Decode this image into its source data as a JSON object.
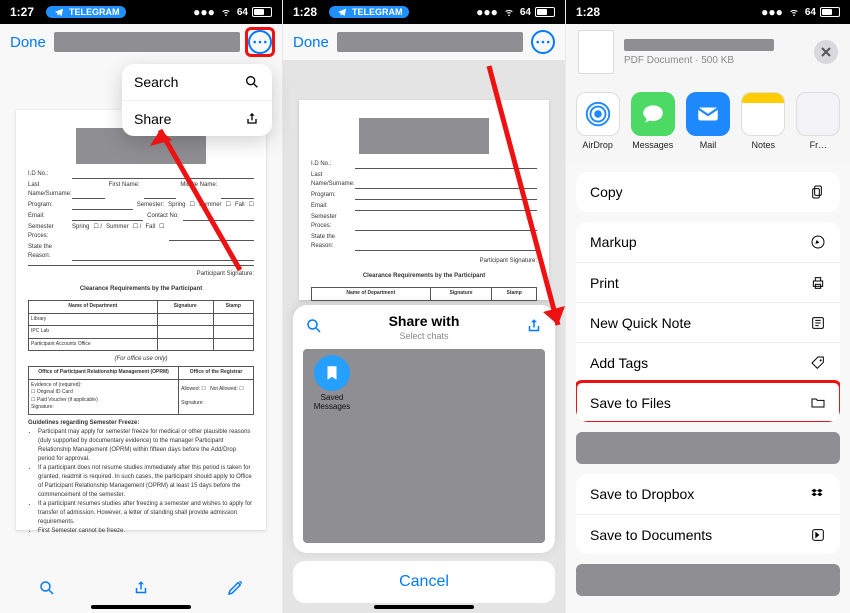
{
  "status": {
    "time1": "1:27",
    "time2": "1:28",
    "time3": "1:28",
    "tg": "TELEGRAM",
    "batt": "64"
  },
  "header": {
    "done": "Done"
  },
  "menu": {
    "search": "Search",
    "share": "Share"
  },
  "doc": {
    "fields": [
      "I.D No.:",
      "Last Name/Surname:",
      "Program:",
      "Email:",
      "Semester Proces:",
      "State the Reason:"
    ],
    "first": "First Name:",
    "middle": "Middle Name:",
    "sem": "Semester:",
    "spring": "Spring",
    "summer": "Summer",
    "fall": "Fall",
    "partSig": "Participant Signature:",
    "h1": "Clearance Requirements by the Participant",
    "cols": [
      "Name of Department",
      "Signature",
      "Stamp"
    ],
    "rows": [
      "Library",
      "IPC Lab",
      "Participant Accounts Office"
    ],
    "foruse": "(For office use only)",
    "left": "Office of Participant Relationship Management (OPRM)",
    "right": "Office of the Registrar",
    "ev": "Evidence of (required):",
    "oc": "Original ID Card",
    "pv": "Paid Voucher (if applicable)",
    "allowed": "Allowed:",
    "notallowed": "Not Allowed:",
    "sig": "Signature:",
    "guidelines": "Guidelines regarding Semester Freeze:",
    "g1": "Participant may apply for semester freeze for medical or other plausible reasons (duly supported by documentary evidence) to the manager Participant Relationship Management (OPRM) within fifteen days before the Add/Drop period for approval.",
    "g2": "If a participant does not resume studies immediately after this period is taken for granted, readmit is required. In such cases, the participant should apply to Office of Participant Relationship Management (OPRM) at least 15 days before the commencement of the semester.",
    "g3": "If a participant resumes studies after freezing a semester and wishes to apply for transfer of admission. However, a letter of standing shall provide admission requirements.",
    "g4": "First Semester cannot be freeze."
  },
  "share": {
    "title": "Share with",
    "sub": "Select chats",
    "saved": "Saved Messages",
    "cancel": "Cancel"
  },
  "p3": {
    "sub": "PDF Document · 500 KB",
    "apps": [
      "AirDrop",
      "Messages",
      "Mail",
      "Notes",
      "Fr…"
    ],
    "copy": "Copy",
    "markup": "Markup",
    "print": "Print",
    "qn": "New Quick Note",
    "tags": "Add Tags",
    "files": "Save to Files",
    "dropbox": "Save to Dropbox",
    "docs": "Save to Documents"
  }
}
